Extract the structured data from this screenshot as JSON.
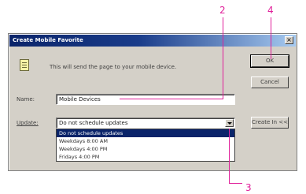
{
  "dialog": {
    "title": "Create Mobile Favorite",
    "close_glyph": "×",
    "message": "This will send the page to your mobile device.",
    "name_label": "Name:",
    "name_value": "Mobile Devices",
    "update_label": "Update:",
    "update_value": "Do not schedule updates",
    "update_options": [
      "Do not schedule updates",
      "Weekdays 8:00 AM",
      "Weekdays 4:00 PM",
      "Fridays 4:00 PM"
    ],
    "selected_option_index": 0,
    "ok_label": "OK",
    "cancel_label": "Cancel",
    "create_label": "Create In <<"
  },
  "callouts": {
    "c2": "2",
    "c3": "3",
    "c4": "4"
  },
  "colors": {
    "callout": "#e0209a",
    "titlebar": "#0a246a",
    "dialog_face": "#d4d0c8"
  }
}
